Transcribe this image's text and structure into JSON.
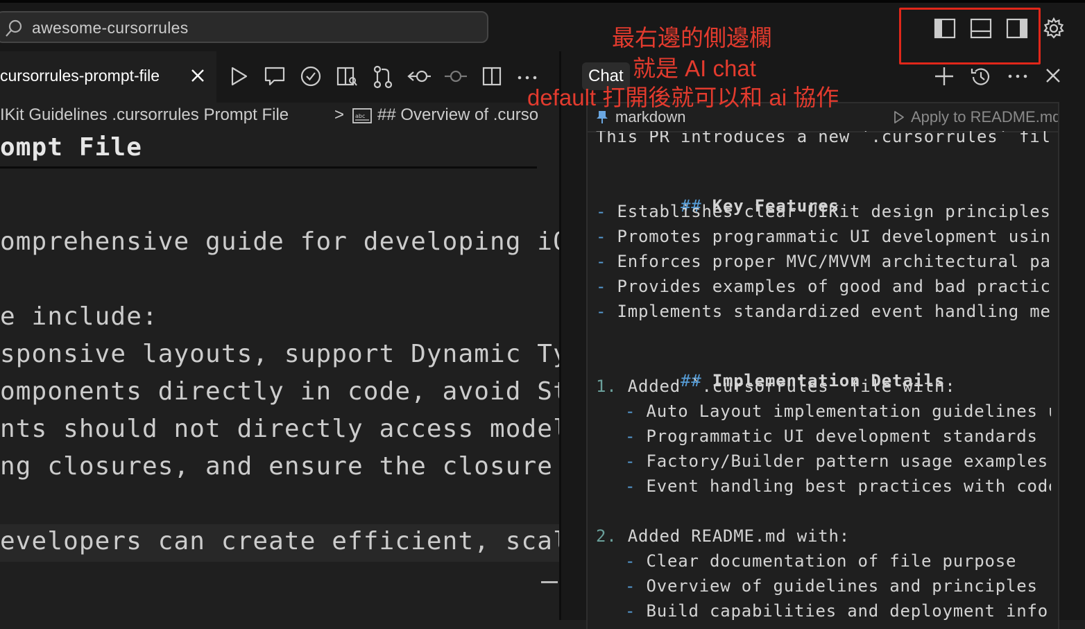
{
  "topbar": {
    "search_text": "awesome-cursorrules"
  },
  "annotation": {
    "line1": "最右邊的側邊欄",
    "line2": "就是 AI chat",
    "line3": "default 打開後就可以和 ai 協作",
    "color": "#e33b2e"
  },
  "editor": {
    "tab_label": "cursorrules-prompt-file",
    "breadcrumb_1": "IKit Guidelines .cursorrules Prompt File",
    "breadcrumb_sep": ">",
    "breadcrumb_2": "## Overview of .curso",
    "lines": [
      "ompt File",
      "",
      "",
      "omprehensive guide for developing iOS",
      "",
      "e include:",
      "sponsive layouts, support Dynamic Type",
      "omponents directly in code, avoid Stor",
      "nts should not directly access models",
      "ng closures, and ensure the closure pa",
      "",
      "evelopers can create efficient, scalab"
    ]
  },
  "chat": {
    "title": "Chat",
    "code_lang": "markdown",
    "apply_label": "Apply to README.md",
    "intro": "This PR introduces a new `.cursorrules` file a",
    "h_key": "Key Features",
    "h_impl": "Implementation Details",
    "hash": "##",
    "bullet": "-",
    "features": [
      "Establishes clear UIKit design principles an",
      "Promotes programmatic UI development using S",
      "Enforces proper MVC/MVVM architectural patte",
      "Provides examples of good and bad practices",
      "Implements standardized event handling mecha"
    ],
    "n1": "1.",
    "item1": "Added `.cursorrules` file with:",
    "item1_sub": [
      "Auto Layout implementation guidelines usi",
      "Programmatic UI development standards",
      "Factory/Builder pattern usage examples",
      "Event handling best practices with code s"
    ],
    "n2": "2.",
    "item2": "Added README.md with:",
    "item2_sub": [
      "Clear documentation of file purpose",
      "Overview of guidelines and principles",
      "Build capabilities and deployment informa"
    ]
  },
  "colors": {
    "accent_red": "#e0271a",
    "background": "#1f1f1f",
    "panel": "#181818"
  },
  "icons": [
    "search-icon",
    "toggle-primary-sidebar-icon",
    "toggle-panel-icon",
    "toggle-secondary-sidebar-icon",
    "settings-gear-icon",
    "close-icon",
    "run-icon",
    "comment-icon",
    "check-icon",
    "preview-icon",
    "source-control-icon",
    "timeline-icon",
    "commit-icon",
    "split-editor-icon",
    "more-icon",
    "plus-icon",
    "history-icon",
    "play-icon",
    "pin-icon",
    "symbol-icon"
  ]
}
